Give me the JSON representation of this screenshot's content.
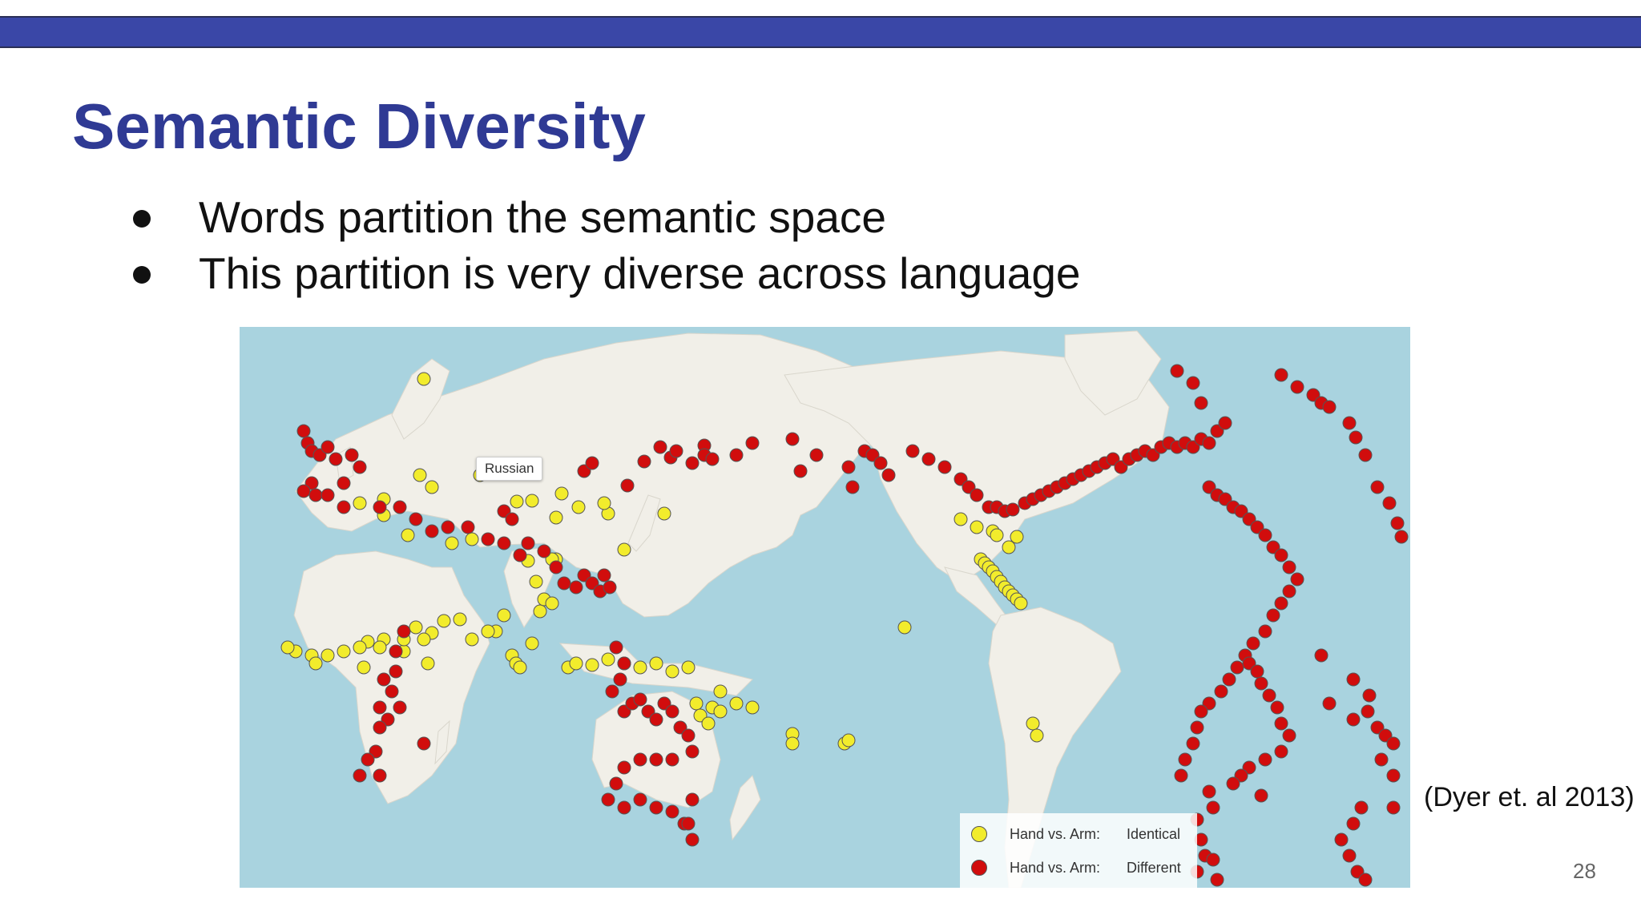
{
  "slide": {
    "title": "Semantic Diversity",
    "bullets": [
      "Words partition the semantic space",
      "This partition is very diverse across language"
    ],
    "citation": "(Dyer et. al 2013)",
    "page_number": "28"
  },
  "map": {
    "tooltip": "Russian",
    "legend": [
      {
        "label": "Hand vs. Arm:",
        "value": "Identical",
        "color": "#f2ec2c"
      },
      {
        "label": "Hand vs. Arm:",
        "value": "Different",
        "color": "#d10d0d"
      }
    ]
  },
  "colors": {
    "accent": "#2f3a94",
    "topbar": "#3a47a7",
    "ocean": "#a9d3df",
    "land": "#f1efe8",
    "identical": "#f2ec2c",
    "different": "#d10d0d"
  }
}
